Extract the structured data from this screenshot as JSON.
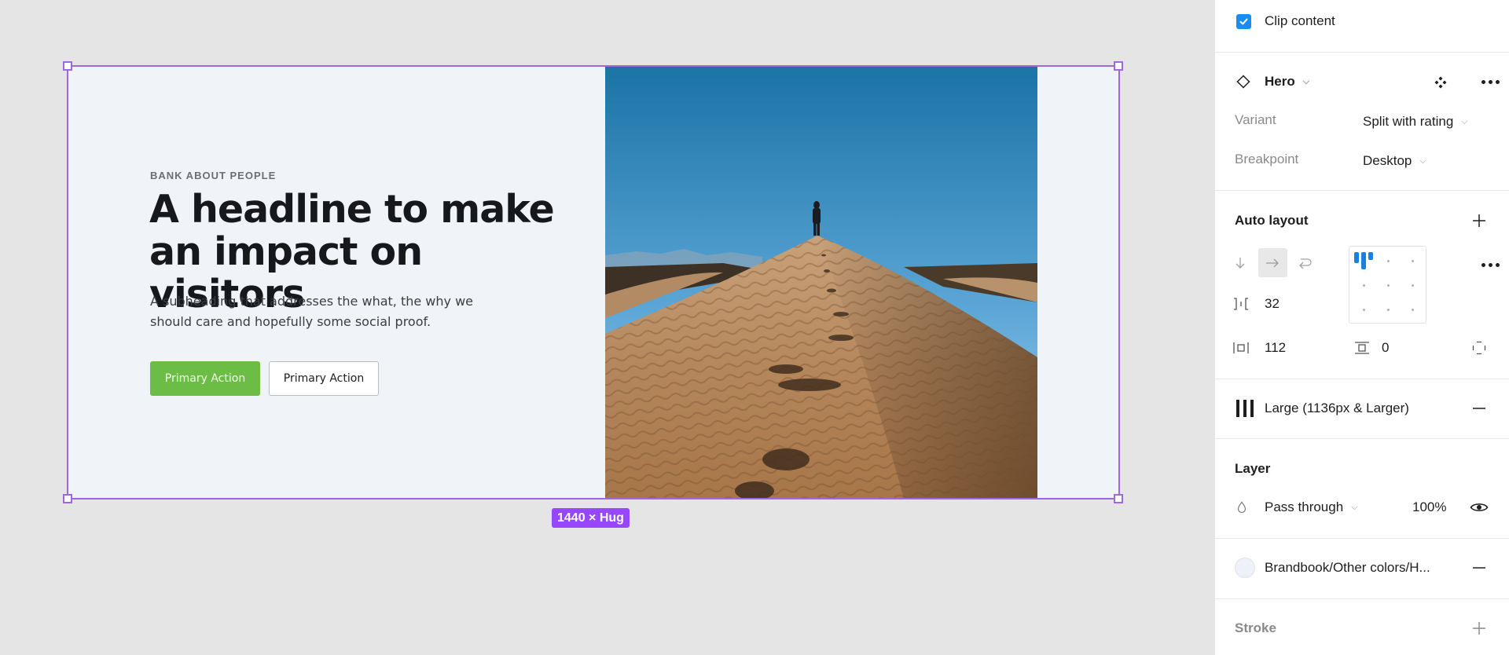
{
  "canvas": {
    "frame_size_badge": "1440 × Hug",
    "hero": {
      "eyebrow": "BANK ABOUT PEOPLE",
      "headline": "A headline to make an impact on visitors",
      "subheading": "A subheading that addresses the what, the why we should care and hopefully some social proof.",
      "primary_button": "Primary Action",
      "secondary_button": "Primary Action",
      "image_alt": "person standing on top of a sand dune with footprints"
    }
  },
  "panel": {
    "clip_content": {
      "label": "Clip content",
      "checked": true
    },
    "component": {
      "icon": "component-instance-icon",
      "name": "Hero",
      "properties": [
        {
          "label": "Variant",
          "value": "Split with rating"
        },
        {
          "label": "Breakpoint",
          "value": "Desktop"
        }
      ]
    },
    "auto_layout": {
      "title": "Auto layout",
      "direction": "horizontal",
      "gap": "32",
      "horizontal_padding": "112",
      "vertical_padding": "0",
      "alignment": "top-left"
    },
    "layout_grid": {
      "label": "Large (1136px & Larger)"
    },
    "layer": {
      "title": "Layer",
      "blend_mode": "Pass through",
      "opacity": "100%"
    },
    "fill": {
      "label": "Brandbook/Other colors/H...",
      "color": "#eef2f8"
    },
    "stroke": {
      "title": "Stroke"
    }
  },
  "colors": {
    "selection": "#9c6ae0",
    "badge": "#9747ff",
    "primary_button": "#6cbd45",
    "checkbox": "#1b8cf0",
    "hero_bg": "#f0f3f8"
  }
}
